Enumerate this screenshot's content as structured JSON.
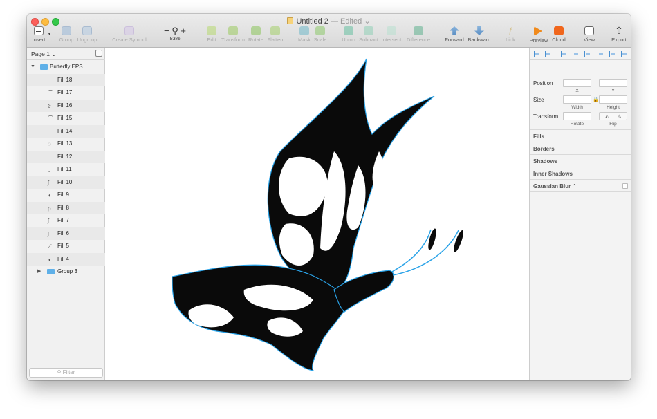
{
  "window": {
    "title": "Untitled 2",
    "status": "— Edited",
    "status_caret": "⌄"
  },
  "toolbar": {
    "insert": "Insert",
    "group": "Group",
    "ungroup": "Ungroup",
    "create_symbol": "Create Symbol",
    "zoom_minus": "−",
    "zoom_plus": "+",
    "zoom_level": "83%",
    "edit": "Edit",
    "transform": "Transform",
    "rotate": "Rotate",
    "flatten": "Flatten",
    "mask": "Mask",
    "scale": "Scale",
    "union": "Union",
    "subtract": "Subtract",
    "intersect": "Intersect",
    "difference": "Difference",
    "forward": "Forward",
    "backward": "Backward",
    "link": "Link",
    "preview": "Preview",
    "cloud": "Cloud",
    "view": "View",
    "export": "Export"
  },
  "sidebar": {
    "page_selector": "Page 1 ⌄",
    "filter_placeholder": "Filter",
    "root_layer": "Butterfly EPS",
    "layers": [
      {
        "label": "Fill 18",
        "glyph": ""
      },
      {
        "label": "Fill 17",
        "glyph": "⌒"
      },
      {
        "label": "Fill 16",
        "glyph": "ϑ"
      },
      {
        "label": "Fill 15",
        "glyph": "⌒"
      },
      {
        "label": "Fill 14",
        "glyph": ""
      },
      {
        "label": "Fill 13",
        "glyph": "◌"
      },
      {
        "label": "Fill 12",
        "glyph": ""
      },
      {
        "label": "Fill 11",
        "glyph": "◟"
      },
      {
        "label": "Fill 10",
        "glyph": "ʃ"
      },
      {
        "label": "Fill 9",
        "glyph": "◖"
      },
      {
        "label": "Fill 8",
        "glyph": "ρ"
      },
      {
        "label": "Fill 7",
        "glyph": "ʃ"
      },
      {
        "label": "Fill 6",
        "glyph": "ʃ"
      },
      {
        "label": "Fill 5",
        "glyph": "⟋"
      },
      {
        "label": "Fill 4",
        "glyph": "◖"
      }
    ],
    "group_layer": "Group 3"
  },
  "inspector": {
    "position": "Position",
    "x": "X",
    "y": "Y",
    "size": "Size",
    "width": "Width",
    "height": "Height",
    "transform": "Transform",
    "rotate": "Rotate",
    "flip": "Flip",
    "fills": "Fills",
    "borders": "Borders",
    "shadows": "Shadows",
    "inner_shadows": "Inner Shadows",
    "gaussian_blur": "Gaussian Blur ⌃"
  },
  "colors": {
    "selection_outline": "#2aa3e8",
    "artwork_fill": "#0a0a0a",
    "artwork_cutout": "#ffffff",
    "folder_icon": "#5fb0e8"
  }
}
